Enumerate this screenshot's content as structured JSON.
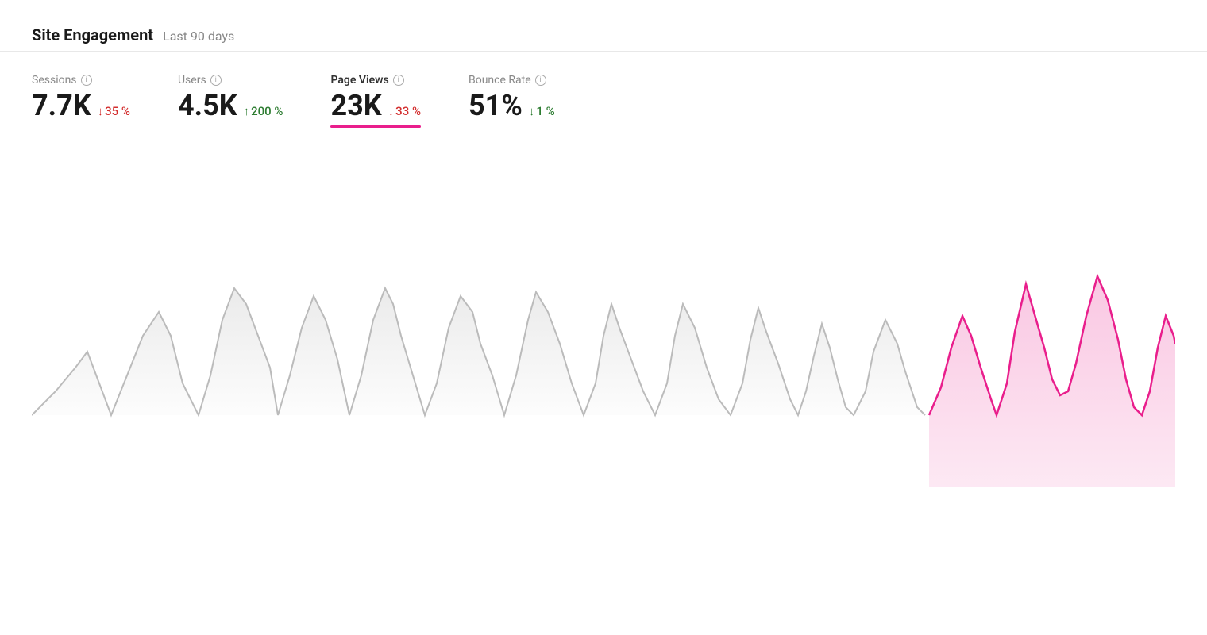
{
  "header": {
    "title": "Site Engagement",
    "subtitle": "Last 90 days"
  },
  "metrics": [
    {
      "id": "sessions",
      "label": "Sessions",
      "value": "7.7K",
      "change": "35 %",
      "direction": "down",
      "sentiment": "bad",
      "active": false
    },
    {
      "id": "users",
      "label": "Users",
      "value": "4.5K",
      "change": "200 %",
      "direction": "up",
      "sentiment": "good",
      "active": false
    },
    {
      "id": "page-views",
      "label": "Page Views",
      "value": "23K",
      "change": "33 %",
      "direction": "down",
      "sentiment": "bad",
      "active": true
    },
    {
      "id": "bounce-rate",
      "label": "Bounce Rate",
      "value": "51%",
      "change": "1 %",
      "direction": "down",
      "sentiment": "good",
      "active": false
    }
  ],
  "chart": {
    "label": "Page Views chart",
    "accent_color": "#e91e8c",
    "accent_fill": "#f8b8d8",
    "base_color": "#cccccc",
    "base_fill": "#eeeeee"
  }
}
